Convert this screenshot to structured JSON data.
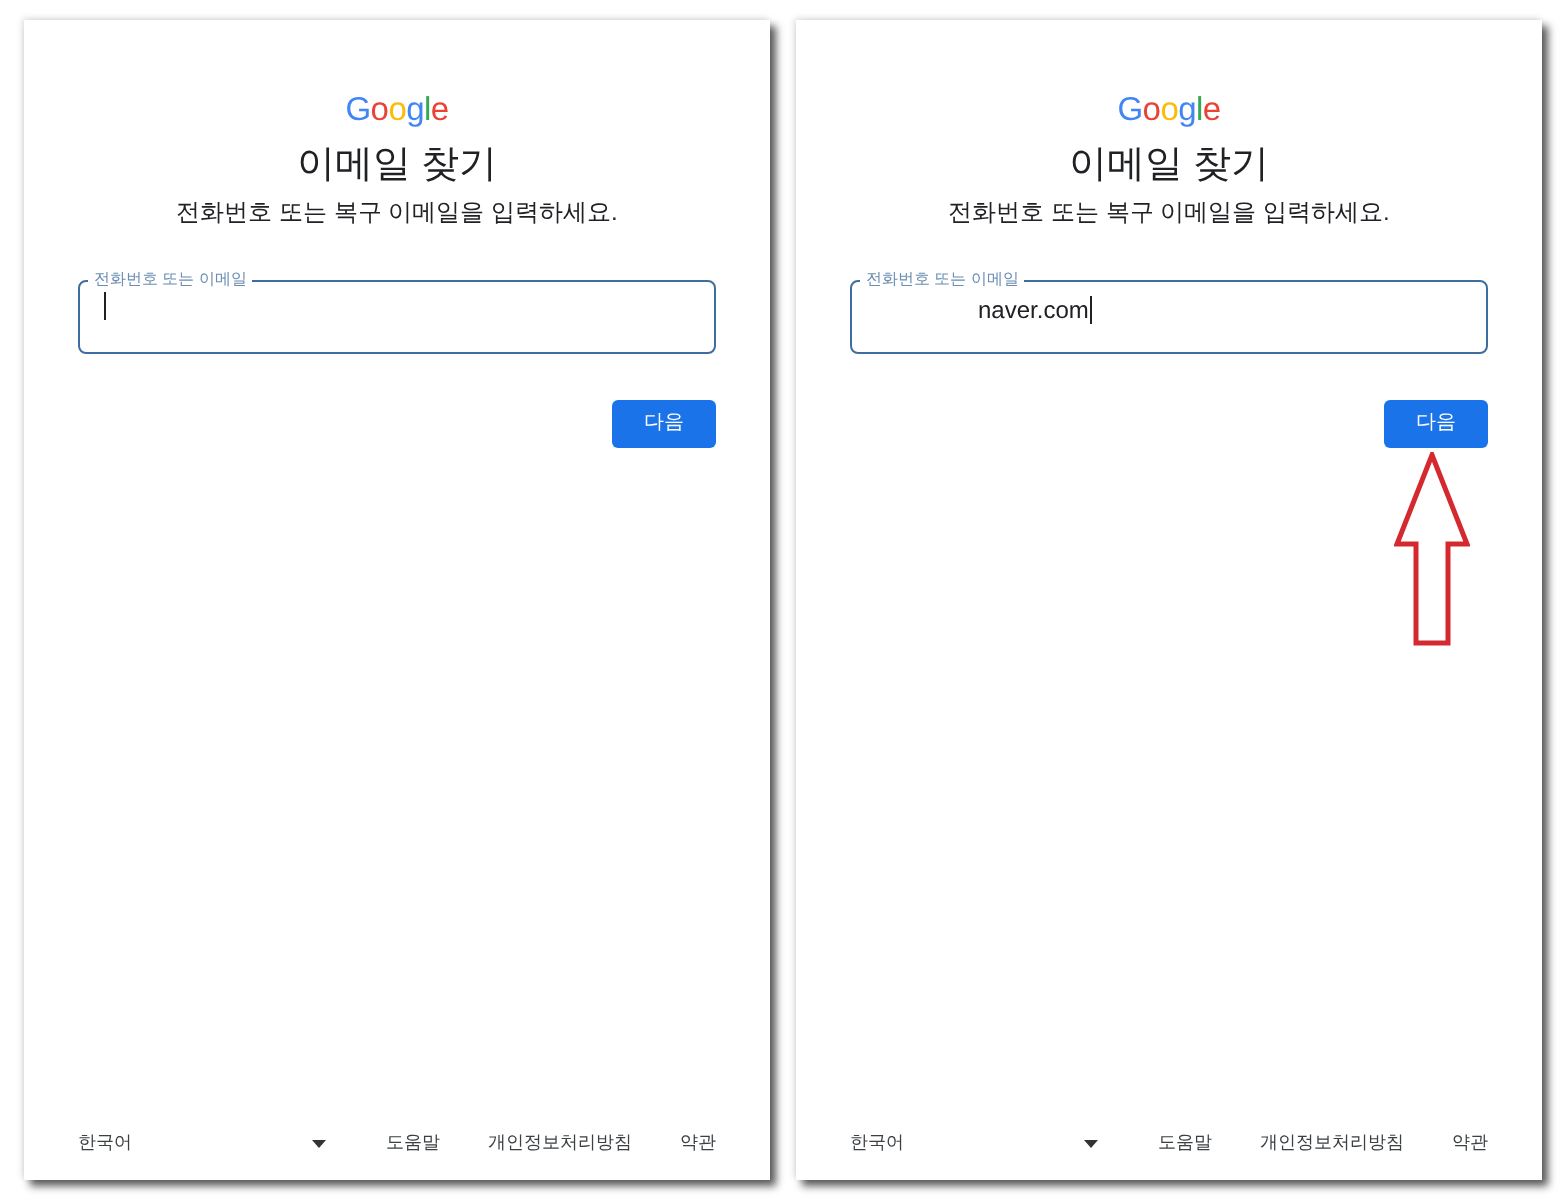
{
  "panels": [
    {
      "logo": "Google",
      "title": "이메일 찾기",
      "subtitle": "전화번호 또는 복구 이메일을 입력하세요.",
      "field": {
        "label": "전화번호 또는 이메일",
        "focused": true,
        "redacted_prefix": false
      },
      "next_button": "다음",
      "arrow": false,
      "footer": {
        "language": "한국어",
        "links": [
          "도움말",
          "개인정보처리방침",
          "약관"
        ]
      }
    },
    {
      "logo": "Google",
      "title": "이메일 찾기",
      "subtitle": "전화번호 또는 복구 이메일을 입력하세요.",
      "field": {
        "label": "전화번호 또는 이메일",
        "value": "naver.com",
        "focused": true,
        "redacted_prefix": true
      },
      "next_button": "다음",
      "arrow": true,
      "footer": {
        "language": "한국어",
        "links": [
          "도움말",
          "개인정보처리방침",
          "약관"
        ]
      }
    }
  ]
}
